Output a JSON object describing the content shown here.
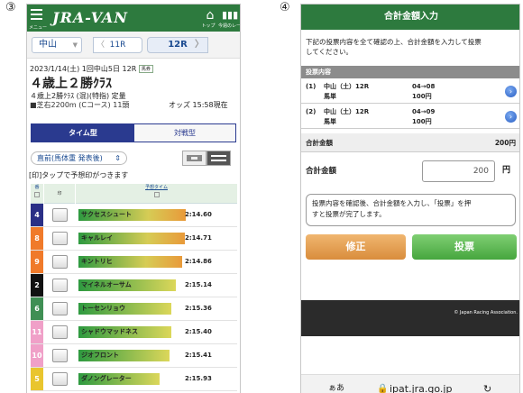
{
  "markers": {
    "left": "③",
    "right": "④"
  },
  "left_screen": {
    "header": {
      "menu_caption": "メニュー",
      "logo": "JRA-VAN",
      "top_caption": "トップ",
      "today_caption": "今週のレース",
      "home_icon": "house-icon",
      "grid_icon": "grid-icon"
    },
    "nav": {
      "venue": "中山",
      "prev_race": "11R",
      "current_race": "12R"
    },
    "race_info": {
      "line1": "2023/1/14(土) 1回中山5日 12R",
      "badge": "馬券",
      "title": "４歳上２勝ｸﾗｽ",
      "line3": "４歳上2勝ｸﾗｽ (混)(特指) 定量",
      "line4": "■芝右2200m (Cコース) 11頭",
      "odds_time": "オッズ 15:58現在"
    },
    "tabs": {
      "active": "タイム型",
      "inactive": "対戦型"
    },
    "sort_label": "直前(馬体重 発表後)",
    "hint": "[印]タップで予想印がつきます",
    "table": {
      "headers": {
        "num": "番",
        "mark": "印",
        "time": "予想タイム"
      },
      "rows": [
        {
          "num": "4",
          "color": "#2a2f86",
          "name": "サクセスシュート",
          "time": "2:14.60",
          "bar": 0.95,
          "hot": true
        },
        {
          "num": "8",
          "color": "#f07a2a",
          "name": "キャルレイ",
          "time": "2:14.71",
          "bar": 0.94,
          "hot": true
        },
        {
          "num": "9",
          "color": "#f07a2a",
          "name": "キントリヒ",
          "time": "2:14.86",
          "bar": 0.92,
          "hot": true
        },
        {
          "num": "2",
          "color": "#111111",
          "name": "マイネルオーサム",
          "time": "2:15.14",
          "bar": 0.86,
          "hot": false
        },
        {
          "num": "6",
          "color": "#3f8f54",
          "name": "トーセンリョウ",
          "time": "2:15.36",
          "bar": 0.82,
          "hot": false
        },
        {
          "num": "11",
          "color": "#f0a0c8",
          "name": "シャドウマッドネス",
          "time": "2:15.40",
          "bar": 0.82,
          "hot": false
        },
        {
          "num": "10",
          "color": "#f0a0c8",
          "name": "ジオフロント",
          "time": "2:15.41",
          "bar": 0.81,
          "hot": false
        },
        {
          "num": "5",
          "color": "#e9c52e",
          "name": "ダノングレーター",
          "time": "2:15.93",
          "bar": 0.72,
          "hot": false
        }
      ]
    }
  },
  "right_screen": {
    "title": "合計金額入力",
    "instructions": [
      "下記の投票内容を全て確認の上、合計金額を入力して投票",
      "してください。"
    ],
    "section": "投票内容",
    "bets": [
      {
        "index": "(1)",
        "race": "中山（土）12R",
        "type": "馬単",
        "combo": "04→08",
        "amount": "100円"
      },
      {
        "index": "(2)",
        "race": "中山（土）12R",
        "type": "馬単",
        "combo": "04→09",
        "amount": "100円"
      }
    ],
    "subtotal_label": "合計金額",
    "subtotal_value": "200円",
    "total_label": "合計金額",
    "total_input": "200",
    "yen": "円",
    "note": [
      "投票内容を確認後、合計金額を入力し、「投票」を押",
      "すと投票が完了します。"
    ],
    "buttons": {
      "fix": "修正",
      "vote": "投票"
    },
    "footer": "© Japan Racing Association.",
    "url": "ipat.jra.go.jp",
    "url_left": "ぁあ",
    "lock_icon": "lock-icon",
    "reload_icon": "reload-icon"
  }
}
